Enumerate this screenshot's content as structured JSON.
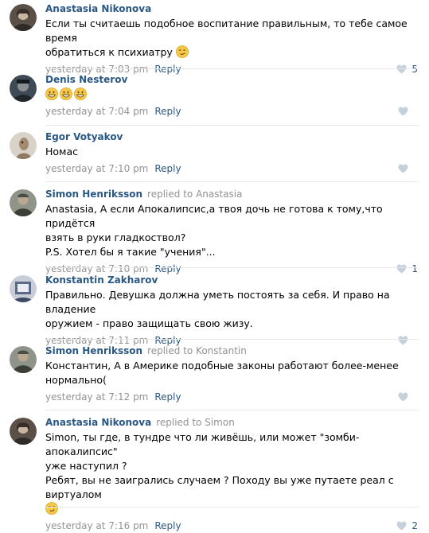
{
  "comments": [
    {
      "author": "Anastasia Nikonova",
      "replied": "",
      "replied_to": "",
      "lines": [
        "Если ты считаешь подобное воспитание правильным, то тебе самое время",
        "обратиться к психиатру"
      ],
      "time": "yesterday at 7:03 pm",
      "reply_label": "Reply",
      "likes": "5",
      "avatar_colors": [
        "#5a5048",
        "#2f2b29"
      ]
    },
    {
      "author": "Denis Nesterov",
      "replied": "",
      "replied_to": "",
      "lines": [
        ""
      ],
      "time": "yesterday at 7:04 pm",
      "reply_label": "Reply",
      "likes": "",
      "avatar_colors": [
        "#3e4a55",
        "#1f262c"
      ]
    },
    {
      "author": "Egor Votyakov",
      "replied": "",
      "replied_to": "",
      "lines": [
        "Номас"
      ],
      "time": "yesterday at 7:10 pm",
      "reply_label": "Reply",
      "likes": "",
      "avatar_colors": [
        "#d8d2c8",
        "#8c7a63"
      ]
    },
    {
      "author": "Simon Henriksson",
      "replied": "replied to",
      "replied_to": "Anastasia",
      "lines": [
        "Anastasia, А если Апокалипсис,а твоя дочь не готова к тому,что придётся",
        "взять в руки гладкоствол?",
        "P.S. Хотел бы я такие \"учения\"..."
      ],
      "time": "yesterday at 7:10 pm",
      "reply_label": "Reply",
      "likes": "1",
      "avatar_colors": [
        "#8f9488",
        "#3b3f37"
      ]
    },
    {
      "author": "Konstantin Zakharov",
      "replied": "",
      "replied_to": "",
      "lines": [
        "Правильно. Девушка должна уметь постоять за себя. И право на владение",
        "оружием - право защищать свою жизу."
      ],
      "time": "yesterday at 7:11 pm",
      "reply_label": "Reply",
      "likes": "",
      "avatar_colors": [
        "#c9cdd8",
        "#5b6a86"
      ]
    },
    {
      "author": "Simon Henriksson",
      "replied": "replied to",
      "replied_to": "Konstantin",
      "lines": [
        "Константин, А в Америке подобные законы работают более-менее",
        "нормально("
      ],
      "time": "yesterday at 7:12 pm",
      "reply_label": "Reply",
      "likes": "",
      "avatar_colors": [
        "#8f9488",
        "#3b3f37"
      ]
    },
    {
      "author": "Anastasia Nikonova",
      "replied": "replied to",
      "replied_to": "Simon",
      "lines": [
        "Simon, ты где, в тундре что ли живёшь, или может \"зомби-апокалипсис\"",
        "уже наступил ?",
        "Ребят, вы не заигрались случаем ? Походу вы уже путаете реал с виртуалом",
        ""
      ],
      "time": "yesterday at 7:16 pm",
      "reply_label": "Reply",
      "likes": "2",
      "avatar_colors": [
        "#5a5048",
        "#2f2b29"
      ]
    }
  ],
  "icons": {
    "like": "heart-icon",
    "smirk_emoji": "smirking-face-emoji",
    "grin_emoji": "grinning-face-emoji"
  },
  "colors": {
    "link": "#2a5885",
    "meta": "#939393",
    "like_empty": "#c5d0db",
    "divider": "#e7e8ec"
  }
}
